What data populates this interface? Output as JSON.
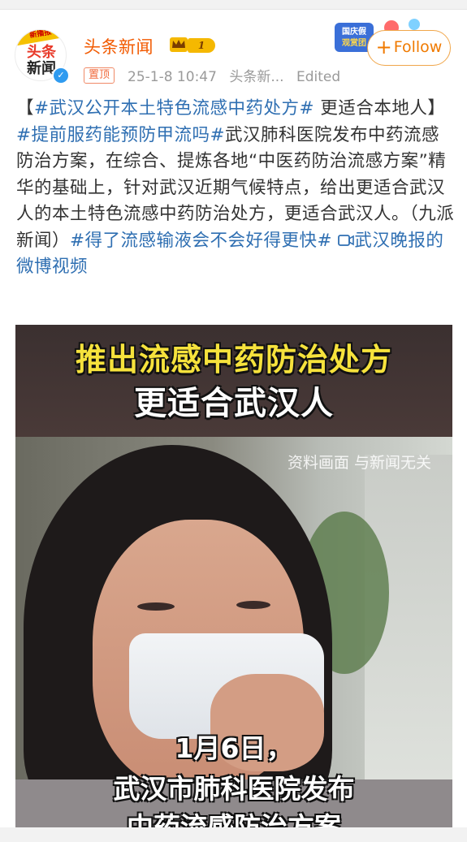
{
  "header": {
    "avatar_ribbon": "新播报",
    "avatar_logo_line1": "头条",
    "avatar_logo_line2": "新闻",
    "username": "头条新闻",
    "level": "1",
    "pinned_label": "置顶",
    "timestamp": "25-1-8 10:47",
    "source": "头条新...",
    "edited": "Edited",
    "badge_text": "国庆假期观赏团",
    "follow_label": "Follow"
  },
  "post": {
    "open_bracket": "【",
    "tag1": "#武汉公开本土特色流感中药处方#",
    "title_rest": " 更适合本地人】",
    "tag2": "#提前服药能预防甲流吗#",
    "body": "武汉肺科医院发布中药流感防治方案，在综合、提炼各地“中医药防治流感方案”精华的基础上，针对武汉近期气候特点，给出更适合武汉人的本土特色流感中药防治处方，更适合武汉人。（九派新闻）",
    "tag3": "#得了流感输液会不会好得更快#",
    "video_link": "武汉晚报的微博视频"
  },
  "video": {
    "headline": "推出流感中药防治处方",
    "subheadline": "更适合武汉人",
    "watermark": "资料画面 与新闻无关",
    "caption_date": "1月6日，",
    "caption_line1": "武汉市肺科医院发布",
    "caption_line2": "中药流感防治方案"
  },
  "colors": {
    "accent_orange": "#f25a00",
    "link_blue": "#2f6fb2",
    "follow_border": "#f0a64a",
    "overlay_yellow": "#f6e23c"
  },
  "icons": [
    "verified-icon",
    "crown-icon",
    "plus-icon",
    "video-link-icon"
  ]
}
